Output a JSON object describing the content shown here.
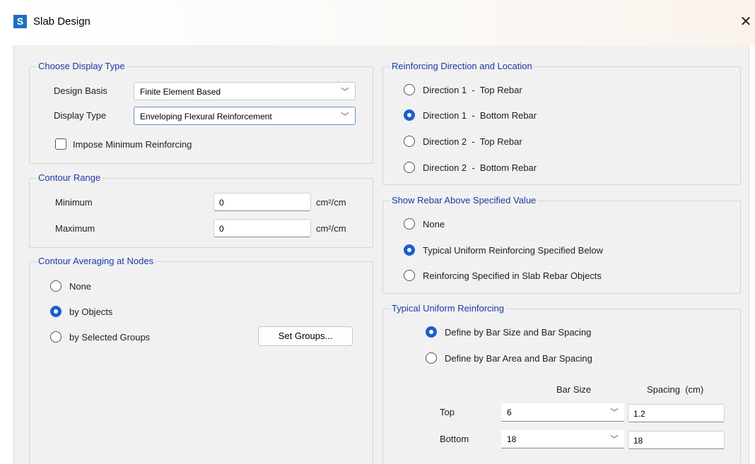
{
  "window": {
    "title": "Slab Design",
    "icon_name": "s-app-icon",
    "close_glyph": "✕"
  },
  "choose_display_type": {
    "title": "Choose Display Type",
    "design_basis_label": "Design Basis",
    "design_basis_value": "Finite Element Based",
    "display_type_label": "Display Type",
    "display_type_value": "Enveloping Flexural Reinforcement",
    "impose_min_label": "Impose Minimum Reinforcing",
    "impose_min_checked": false
  },
  "contour_range": {
    "title": "Contour Range",
    "min_label": "Minimum",
    "min_value": "0",
    "min_unit": "cm²/cm",
    "max_label": "Maximum",
    "max_value": "0",
    "max_unit": "cm²/cm"
  },
  "contour_averaging": {
    "title": "Contour Averaging at Nodes",
    "options": [
      "None",
      "by Objects",
      "by Selected Groups"
    ],
    "selected": "by Objects",
    "set_groups_label": "Set Groups..."
  },
  "reinforcing_direction": {
    "title": "Reinforcing Direction and Location",
    "options": [
      "Direction 1  -  Top Rebar",
      "Direction 1  -  Bottom Rebar",
      "Direction 2  -  Top Rebar",
      "Direction 2  -  Bottom Rebar"
    ],
    "selected": "Direction 1  -  Bottom Rebar"
  },
  "show_rebar": {
    "title": "Show Rebar Above Specified Value",
    "options": [
      "None",
      "Typical Uniform Reinforcing Specified Below",
      "Reinforcing Specified in Slab Rebar Objects"
    ],
    "selected": "Typical Uniform Reinforcing Specified Below"
  },
  "typical_uniform": {
    "title": "Typical Uniform Reinforcing",
    "options": [
      "Define by Bar Size and Bar Spacing",
      "Define by Bar Area and Bar Spacing"
    ],
    "selected": "Define by Bar Size and Bar Spacing",
    "bar_size_header": "Bar Size",
    "spacing_header": "Spacing  (cm)",
    "top_label": "Top",
    "top_bar_size": "6",
    "top_spacing": "1.2",
    "bottom_label": "Bottom",
    "bottom_bar_size": "18",
    "bottom_spacing": "18"
  },
  "colors": {
    "accent": "#1a5fcf",
    "group_title": "#1a3aa8",
    "panel_bg": "#f1f1f1"
  }
}
